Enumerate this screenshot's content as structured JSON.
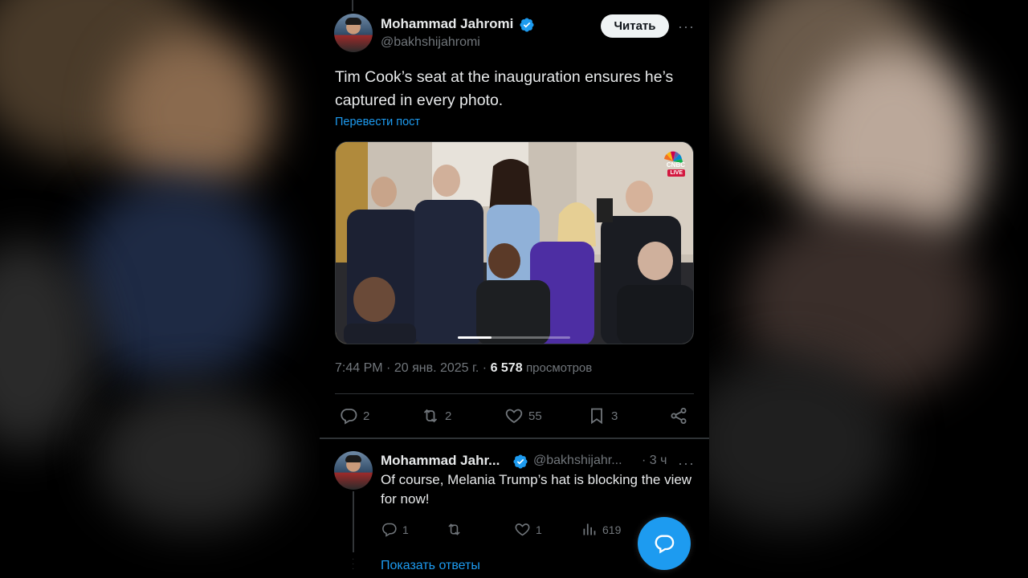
{
  "tweet": {
    "author_name": "Mohammad Jahromi",
    "author_handle": "@bakhshijahromi",
    "follow_label": "Читать",
    "more_label": "···",
    "text": "Tim Cook’s seat at the inauguration ensures he’s captured in every photo.",
    "translate_label": "Перевести пост",
    "time": "7:44 PM",
    "date": "20 янв. 2025 г.",
    "views_count": "6 578",
    "views_label": "просмотров",
    "media": {
      "overlay_logo": "CNBC",
      "overlay_badge": "LIVE",
      "video_progress": 0.3
    },
    "actions": {
      "replies": "2",
      "reposts": "2",
      "likes": "55",
      "bookmarks": "3"
    }
  },
  "reply": {
    "author_name": "Mohammad Jahr...",
    "author_handle": "@bakhshijahr...",
    "time": "· 3 ч",
    "more_label": "···",
    "text": "Of course, Melania Trump’s hat is blocking the view for now!",
    "actions": {
      "replies": "1",
      "likes": "1",
      "views": "619"
    },
    "show_replies_label": "Показать ответы"
  },
  "colors": {
    "accent": "#1d9bf0",
    "background": "#000000",
    "muted_text": "#71767b",
    "primary_text": "#e7e9ea"
  },
  "icons": [
    "verified-icon",
    "reply-icon",
    "repost-icon",
    "like-icon",
    "bookmark-icon",
    "share-icon",
    "views-icon",
    "compose-icon"
  ]
}
